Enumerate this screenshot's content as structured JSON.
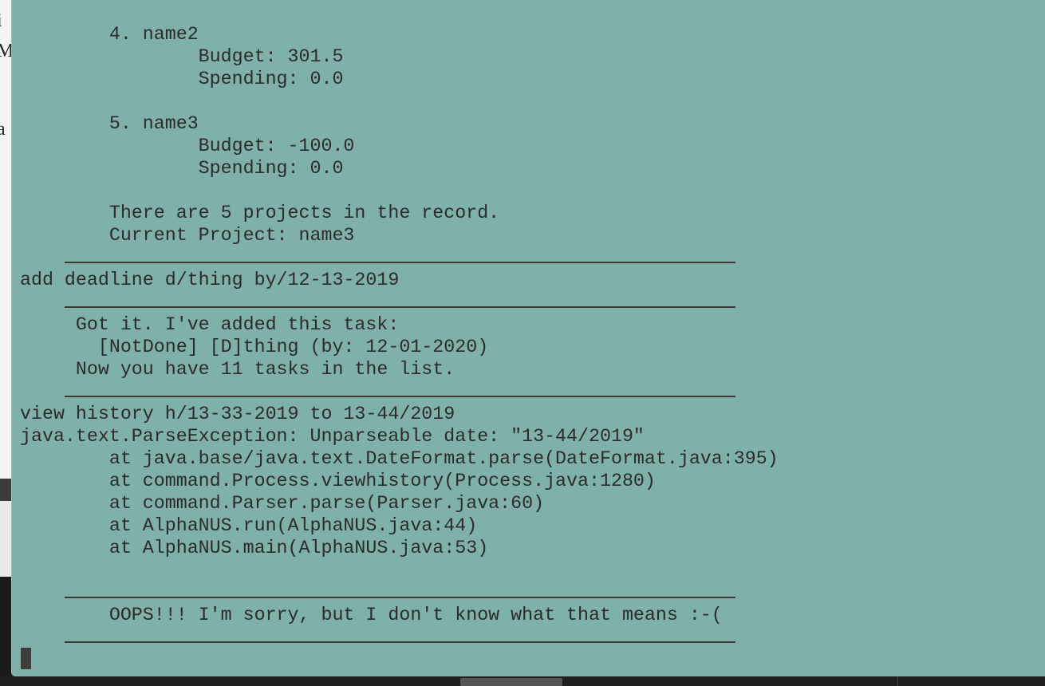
{
  "background_document": {
    "fragments": [
      "i",
      "M",
      "a"
    ]
  },
  "terminal": {
    "lines": [
      {
        "kind": "text",
        "text": "        4. name2"
      },
      {
        "kind": "text",
        "text": "                Budget: 301.5"
      },
      {
        "kind": "text",
        "text": "                Spending: 0.0"
      },
      {
        "kind": "text",
        "text": ""
      },
      {
        "kind": "text",
        "text": "        5. name3"
      },
      {
        "kind": "text",
        "text": "                Budget: -100.0"
      },
      {
        "kind": "text",
        "text": "                Spending: 0.0"
      },
      {
        "kind": "text",
        "text": ""
      },
      {
        "kind": "text",
        "text": "        There are 5 projects in the record."
      },
      {
        "kind": "text",
        "text": "        Current Project: name3"
      },
      {
        "kind": "rule",
        "text": ""
      },
      {
        "kind": "text",
        "text": "add deadline d/thing by/12-13-2019"
      },
      {
        "kind": "rule",
        "text": ""
      },
      {
        "kind": "text",
        "text": "     Got it. I've added this task:"
      },
      {
        "kind": "text",
        "text": "       [NotDone] [D]thing (by: 12-01-2020)"
      },
      {
        "kind": "text",
        "text": "     Now you have 11 tasks in the list."
      },
      {
        "kind": "rule",
        "text": ""
      },
      {
        "kind": "text",
        "text": "view history h/13-33-2019 to 13-44/2019"
      },
      {
        "kind": "text",
        "text": "java.text.ParseException: Unparseable date: \"13-44/2019\""
      },
      {
        "kind": "text",
        "text": "        at java.base/java.text.DateFormat.parse(DateFormat.java:395)"
      },
      {
        "kind": "text",
        "text": "        at command.Process.viewhistory(Process.java:1280)"
      },
      {
        "kind": "text",
        "text": "        at command.Parser.parse(Parser.java:60)"
      },
      {
        "kind": "text",
        "text": "        at AlphaNUS.run(AlphaNUS.java:44)"
      },
      {
        "kind": "text",
        "text": "        at AlphaNUS.main(AlphaNUS.java:53)"
      },
      {
        "kind": "text",
        "text": ""
      },
      {
        "kind": "rule",
        "text": ""
      },
      {
        "kind": "text",
        "text": "        OOPS!!! I'm sorry, but I don't know what that means :-("
      },
      {
        "kind": "rule",
        "text": ""
      }
    ]
  },
  "colors": {
    "terminal_background": "#7fb0aa",
    "terminal_text": "#2b2b2b"
  }
}
